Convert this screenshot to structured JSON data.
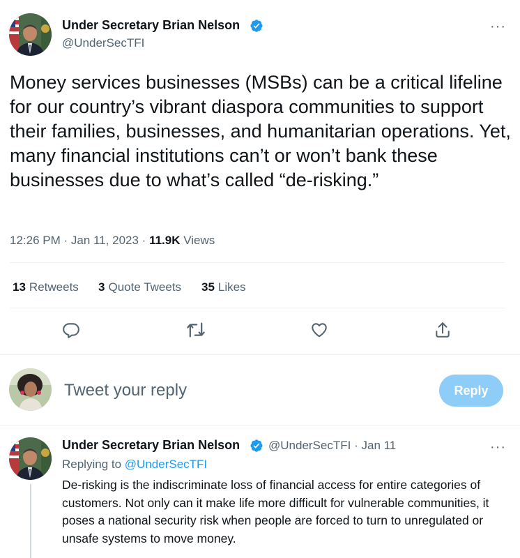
{
  "main_tweet": {
    "author_name": "Under Secretary Brian Nelson",
    "author_handle": "@UnderSecTFI",
    "text": "Money services businesses (MSBs) can be a critical lifeline for our country’s vibrant diaspora communities to support their families, businesses, and humanitarian operations. Yet, many financial institutions can’t or won’t bank these businesses due to what’s called “de-risking.”",
    "time": "12:26 PM",
    "date": "Jan 11, 2023",
    "views_count": "11.9K",
    "views_label": "Views",
    "more": "···"
  },
  "stats": {
    "retweets_count": "13",
    "retweets_label": "Retweets",
    "quotes_count": "3",
    "quotes_label": "Quote Tweets",
    "likes_count": "35",
    "likes_label": "Likes"
  },
  "actions": [
    "reply-icon",
    "retweet-icon",
    "like-icon",
    "share-icon"
  ],
  "composer": {
    "placeholder": "Tweet your reply",
    "button_label": "Reply"
  },
  "reply_tweet": {
    "author_name": "Under Secretary Brian Nelson",
    "author_handle": "@UnderSecTFI",
    "date": "Jan 11",
    "replying_prefix": "Replying to",
    "replying_handle": "@UnderSecTFI",
    "text": "De-risking is the indiscriminate loss of financial access for entire categories of customers. Not only can it make life more difficult for vulnerable communities, it poses a national security risk when people are forced to turn to unregulated or unsafe systems to move money.",
    "more": "···"
  },
  "colors": {
    "verified": "#1d9bf0",
    "link": "#1d9bf0",
    "reply_button": "#8ecdf8",
    "secondary_text": "#536471"
  }
}
